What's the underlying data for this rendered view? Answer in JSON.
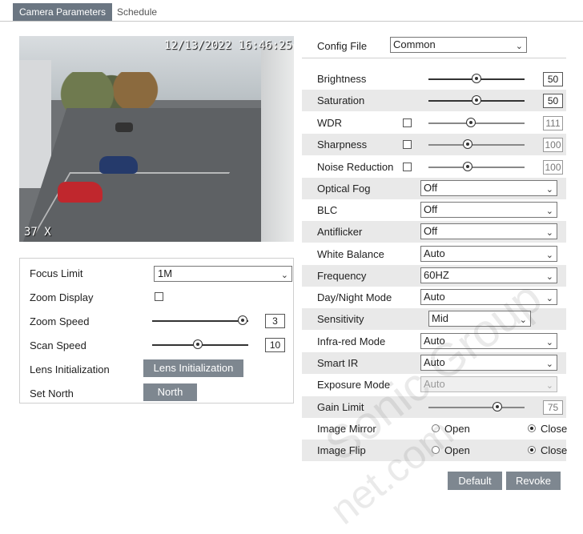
{
  "tabs": [
    {
      "label": "Camera Parameters",
      "active": true
    },
    {
      "label": "Schedule",
      "active": false
    }
  ],
  "video": {
    "timestamp": "12/13/2022 16:46:25",
    "zoom_readout": "37 X"
  },
  "ptz": {
    "focus_limit": {
      "label": "Focus Limit",
      "value": "1M"
    },
    "zoom_display": {
      "label": "Zoom Display",
      "checked": false
    },
    "zoom_speed": {
      "label": "Zoom Speed",
      "value": "3"
    },
    "scan_speed": {
      "label": "Scan Speed",
      "value": "10"
    },
    "lens_init": {
      "label": "Lens Initialization",
      "button": "Lens Initialization"
    },
    "set_north": {
      "label": "Set North",
      "button": "North"
    }
  },
  "config": {
    "label": "Config File",
    "value": "Common"
  },
  "image": {
    "brightness": {
      "label": "Brightness",
      "value": "50"
    },
    "saturation": {
      "label": "Saturation",
      "value": "50"
    },
    "wdr": {
      "label": "WDR",
      "value": "111",
      "checked": false
    },
    "sharpness": {
      "label": "Sharpness",
      "value": "100",
      "checked": false
    },
    "noise_reduction": {
      "label": "Noise Reduction",
      "value": "100",
      "checked": false
    },
    "optical_fog": {
      "label": "Optical Fog",
      "value": "Off"
    },
    "blc": {
      "label": "BLC",
      "value": "Off"
    },
    "antiflicker": {
      "label": "Antiflicker",
      "value": "Off"
    },
    "white_balance": {
      "label": "White Balance",
      "value": "Auto"
    },
    "frequency": {
      "label": "Frequency",
      "value": "60HZ"
    },
    "day_night": {
      "label": "Day/Night Mode",
      "value": "Auto"
    },
    "sensitivity": {
      "label": "Sensitivity",
      "value": "Mid"
    },
    "infrared": {
      "label": "Infra-red Mode",
      "value": "Auto"
    },
    "smart_ir": {
      "label": "Smart IR",
      "value": "Auto"
    },
    "exposure": {
      "label": "Exposure Mode",
      "value": "Auto"
    },
    "gain_limit": {
      "label": "Gain Limit",
      "value": "75"
    },
    "mirror": {
      "label": "Image Mirror",
      "open": "Open",
      "close": "Close",
      "selected": "Close"
    },
    "flip": {
      "label": "Image Flip",
      "open": "Open",
      "close": "Close",
      "selected": "Close"
    }
  },
  "buttons": {
    "default": "Default",
    "revoke": "Revoke"
  },
  "watermark": {
    "line1": "Sonic Group",
    "line2": "net.com"
  }
}
